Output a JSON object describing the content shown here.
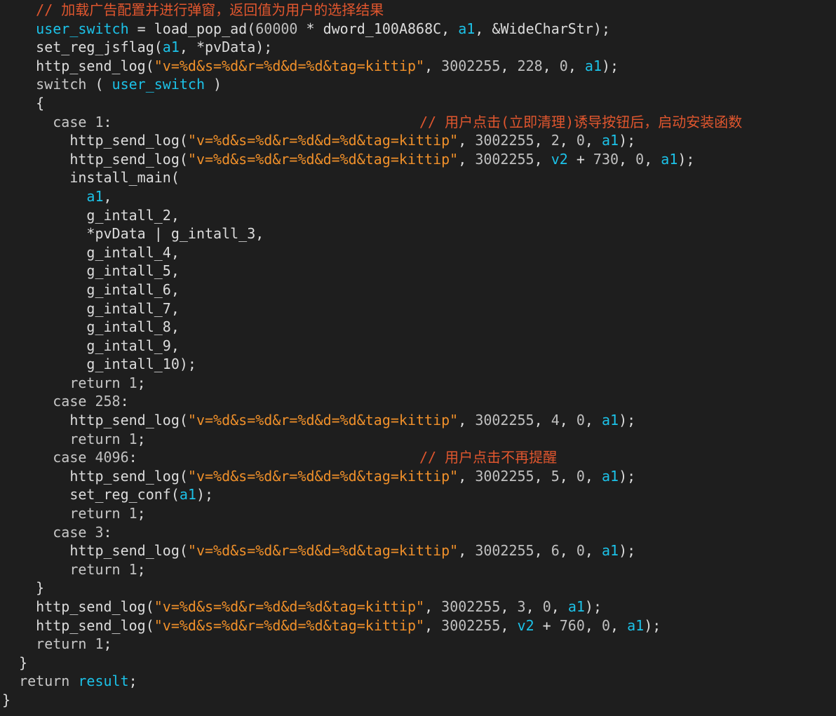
{
  "colors": {
    "background": "#1e1e1e",
    "plain": "#dcdcdc",
    "keyword": "#c8c8c8",
    "variable": "#1cc2e8",
    "string": "#f0902a",
    "number": "#c0c0c0",
    "comment": "#e0562e"
  },
  "lines": [
    {
      "indent": 2,
      "tokens": [
        {
          "t": "// 加载广告配置并进行弹窗，返回值为用户的选择结果",
          "c": "comment"
        }
      ]
    },
    {
      "indent": 2,
      "tokens": [
        {
          "t": "user_switch",
          "c": "variable"
        },
        {
          "t": " = load_pop_ad(",
          "c": "plain"
        },
        {
          "t": "60000",
          "c": "number"
        },
        {
          "t": " * dword_100A868C, ",
          "c": "plain"
        },
        {
          "t": "a1",
          "c": "variable"
        },
        {
          "t": ", &WideCharStr);",
          "c": "plain"
        }
      ]
    },
    {
      "indent": 2,
      "tokens": [
        {
          "t": "set_reg_jsflag(",
          "c": "plain"
        },
        {
          "t": "a1",
          "c": "variable"
        },
        {
          "t": ", *pvData);",
          "c": "plain"
        }
      ]
    },
    {
      "indent": 2,
      "tokens": [
        {
          "t": "http_send_log(",
          "c": "plain"
        },
        {
          "t": "\"v=%d&s=%d&r=%d&d=%d&tag=kittip\"",
          "c": "string"
        },
        {
          "t": ", ",
          "c": "plain"
        },
        {
          "t": "3002255",
          "c": "number"
        },
        {
          "t": ", ",
          "c": "plain"
        },
        {
          "t": "228",
          "c": "number"
        },
        {
          "t": ", ",
          "c": "plain"
        },
        {
          "t": "0",
          "c": "number"
        },
        {
          "t": ", ",
          "c": "plain"
        },
        {
          "t": "a1",
          "c": "variable"
        },
        {
          "t": ");",
          "c": "plain"
        }
      ]
    },
    {
      "indent": 2,
      "tokens": [
        {
          "t": "switch",
          "c": "keyword"
        },
        {
          "t": " ( ",
          "c": "plain"
        },
        {
          "t": "user_switch",
          "c": "variable"
        },
        {
          "t": " )",
          "c": "plain"
        }
      ]
    },
    {
      "indent": 2,
      "tokens": [
        {
          "t": "{",
          "c": "plain"
        }
      ]
    },
    {
      "indent": 3,
      "tokens": [
        {
          "t": "case",
          "c": "keyword"
        },
        {
          "t": " ",
          "c": "plain"
        },
        {
          "t": "1",
          "c": "number"
        },
        {
          "t": ":",
          "c": "plain"
        }
      ],
      "right_comment": "// 用户点击(立即清理)诱导按钮后，启动安装函数"
    },
    {
      "indent": 4,
      "tokens": [
        {
          "t": "http_send_log(",
          "c": "plain"
        },
        {
          "t": "\"v=%d&s=%d&r=%d&d=%d&tag=kittip\"",
          "c": "string"
        },
        {
          "t": ", ",
          "c": "plain"
        },
        {
          "t": "3002255",
          "c": "number"
        },
        {
          "t": ", ",
          "c": "plain"
        },
        {
          "t": "2",
          "c": "number"
        },
        {
          "t": ", ",
          "c": "plain"
        },
        {
          "t": "0",
          "c": "number"
        },
        {
          "t": ", ",
          "c": "plain"
        },
        {
          "t": "a1",
          "c": "variable"
        },
        {
          "t": ");",
          "c": "plain"
        }
      ]
    },
    {
      "indent": 4,
      "tokens": [
        {
          "t": "http_send_log(",
          "c": "plain"
        },
        {
          "t": "\"v=%d&s=%d&r=%d&d=%d&tag=kittip\"",
          "c": "string"
        },
        {
          "t": ", ",
          "c": "plain"
        },
        {
          "t": "3002255",
          "c": "number"
        },
        {
          "t": ", ",
          "c": "plain"
        },
        {
          "t": "v2",
          "c": "variable"
        },
        {
          "t": " + ",
          "c": "plain"
        },
        {
          "t": "730",
          "c": "number"
        },
        {
          "t": ", ",
          "c": "plain"
        },
        {
          "t": "0",
          "c": "number"
        },
        {
          "t": ", ",
          "c": "plain"
        },
        {
          "t": "a1",
          "c": "variable"
        },
        {
          "t": ");",
          "c": "plain"
        }
      ]
    },
    {
      "indent": 4,
      "tokens": [
        {
          "t": "install_main(",
          "c": "plain"
        }
      ]
    },
    {
      "indent": 5,
      "tokens": [
        {
          "t": "a1",
          "c": "variable"
        },
        {
          "t": ",",
          "c": "plain"
        }
      ]
    },
    {
      "indent": 5,
      "tokens": [
        {
          "t": "g_intall_2,",
          "c": "plain"
        }
      ]
    },
    {
      "indent": 5,
      "tokens": [
        {
          "t": "*pvData | g_intall_3,",
          "c": "plain"
        }
      ]
    },
    {
      "indent": 5,
      "tokens": [
        {
          "t": "g_intall_4,",
          "c": "plain"
        }
      ]
    },
    {
      "indent": 5,
      "tokens": [
        {
          "t": "g_intall_5,",
          "c": "plain"
        }
      ]
    },
    {
      "indent": 5,
      "tokens": [
        {
          "t": "g_intall_6,",
          "c": "plain"
        }
      ]
    },
    {
      "indent": 5,
      "tokens": [
        {
          "t": "g_intall_7,",
          "c": "plain"
        }
      ]
    },
    {
      "indent": 5,
      "tokens": [
        {
          "t": "g_intall_8,",
          "c": "plain"
        }
      ]
    },
    {
      "indent": 5,
      "tokens": [
        {
          "t": "g_intall_9,",
          "c": "plain"
        }
      ]
    },
    {
      "indent": 5,
      "tokens": [
        {
          "t": "g_intall_10);",
          "c": "plain"
        }
      ]
    },
    {
      "indent": 4,
      "tokens": [
        {
          "t": "return",
          "c": "keyword"
        },
        {
          "t": " ",
          "c": "plain"
        },
        {
          "t": "1",
          "c": "number"
        },
        {
          "t": ";",
          "c": "plain"
        }
      ]
    },
    {
      "indent": 3,
      "tokens": [
        {
          "t": "case",
          "c": "keyword"
        },
        {
          "t": " ",
          "c": "plain"
        },
        {
          "t": "258",
          "c": "number"
        },
        {
          "t": ":",
          "c": "plain"
        }
      ]
    },
    {
      "indent": 4,
      "tokens": [
        {
          "t": "http_send_log(",
          "c": "plain"
        },
        {
          "t": "\"v=%d&s=%d&r=%d&d=%d&tag=kittip\"",
          "c": "string"
        },
        {
          "t": ", ",
          "c": "plain"
        },
        {
          "t": "3002255",
          "c": "number"
        },
        {
          "t": ", ",
          "c": "plain"
        },
        {
          "t": "4",
          "c": "number"
        },
        {
          "t": ", ",
          "c": "plain"
        },
        {
          "t": "0",
          "c": "number"
        },
        {
          "t": ", ",
          "c": "plain"
        },
        {
          "t": "a1",
          "c": "variable"
        },
        {
          "t": ");",
          "c": "plain"
        }
      ]
    },
    {
      "indent": 4,
      "tokens": [
        {
          "t": "return",
          "c": "keyword"
        },
        {
          "t": " ",
          "c": "plain"
        },
        {
          "t": "1",
          "c": "number"
        },
        {
          "t": ";",
          "c": "plain"
        }
      ]
    },
    {
      "indent": 3,
      "tokens": [
        {
          "t": "case",
          "c": "keyword"
        },
        {
          "t": " ",
          "c": "plain"
        },
        {
          "t": "4096",
          "c": "number"
        },
        {
          "t": ":",
          "c": "plain"
        }
      ],
      "right_comment": "// 用户点击不再提醒"
    },
    {
      "indent": 4,
      "tokens": [
        {
          "t": "http_send_log(",
          "c": "plain"
        },
        {
          "t": "\"v=%d&s=%d&r=%d&d=%d&tag=kittip\"",
          "c": "string"
        },
        {
          "t": ", ",
          "c": "plain"
        },
        {
          "t": "3002255",
          "c": "number"
        },
        {
          "t": ", ",
          "c": "plain"
        },
        {
          "t": "5",
          "c": "number"
        },
        {
          "t": ", ",
          "c": "plain"
        },
        {
          "t": "0",
          "c": "number"
        },
        {
          "t": ", ",
          "c": "plain"
        },
        {
          "t": "a1",
          "c": "variable"
        },
        {
          "t": ");",
          "c": "plain"
        }
      ]
    },
    {
      "indent": 4,
      "tokens": [
        {
          "t": "set_reg_conf(",
          "c": "plain"
        },
        {
          "t": "a1",
          "c": "variable"
        },
        {
          "t": ");",
          "c": "plain"
        }
      ]
    },
    {
      "indent": 4,
      "tokens": [
        {
          "t": "return",
          "c": "keyword"
        },
        {
          "t": " ",
          "c": "plain"
        },
        {
          "t": "1",
          "c": "number"
        },
        {
          "t": ";",
          "c": "plain"
        }
      ]
    },
    {
      "indent": 3,
      "tokens": [
        {
          "t": "case",
          "c": "keyword"
        },
        {
          "t": " ",
          "c": "plain"
        },
        {
          "t": "3",
          "c": "number"
        },
        {
          "t": ":",
          "c": "plain"
        }
      ]
    },
    {
      "indent": 4,
      "tokens": [
        {
          "t": "http_send_log(",
          "c": "plain"
        },
        {
          "t": "\"v=%d&s=%d&r=%d&d=%d&tag=kittip\"",
          "c": "string"
        },
        {
          "t": ", ",
          "c": "plain"
        },
        {
          "t": "3002255",
          "c": "number"
        },
        {
          "t": ", ",
          "c": "plain"
        },
        {
          "t": "6",
          "c": "number"
        },
        {
          "t": ", ",
          "c": "plain"
        },
        {
          "t": "0",
          "c": "number"
        },
        {
          "t": ", ",
          "c": "plain"
        },
        {
          "t": "a1",
          "c": "variable"
        },
        {
          "t": ");",
          "c": "plain"
        }
      ]
    },
    {
      "indent": 4,
      "tokens": [
        {
          "t": "return",
          "c": "keyword"
        },
        {
          "t": " ",
          "c": "plain"
        },
        {
          "t": "1",
          "c": "number"
        },
        {
          "t": ";",
          "c": "plain"
        }
      ]
    },
    {
      "indent": 2,
      "tokens": [
        {
          "t": "}",
          "c": "plain"
        }
      ]
    },
    {
      "indent": 2,
      "tokens": [
        {
          "t": "http_send_log(",
          "c": "plain"
        },
        {
          "t": "\"v=%d&s=%d&r=%d&d=%d&tag=kittip\"",
          "c": "string"
        },
        {
          "t": ", ",
          "c": "plain"
        },
        {
          "t": "3002255",
          "c": "number"
        },
        {
          "t": ", ",
          "c": "plain"
        },
        {
          "t": "3",
          "c": "number"
        },
        {
          "t": ", ",
          "c": "plain"
        },
        {
          "t": "0",
          "c": "number"
        },
        {
          "t": ", ",
          "c": "plain"
        },
        {
          "t": "a1",
          "c": "variable"
        },
        {
          "t": ");",
          "c": "plain"
        }
      ]
    },
    {
      "indent": 2,
      "tokens": [
        {
          "t": "http_send_log(",
          "c": "plain"
        },
        {
          "t": "\"v=%d&s=%d&r=%d&d=%d&tag=kittip\"",
          "c": "string"
        },
        {
          "t": ", ",
          "c": "plain"
        },
        {
          "t": "3002255",
          "c": "number"
        },
        {
          "t": ", ",
          "c": "plain"
        },
        {
          "t": "v2",
          "c": "variable"
        },
        {
          "t": " + ",
          "c": "plain"
        },
        {
          "t": "760",
          "c": "number"
        },
        {
          "t": ", ",
          "c": "plain"
        },
        {
          "t": "0",
          "c": "number"
        },
        {
          "t": ", ",
          "c": "plain"
        },
        {
          "t": "a1",
          "c": "variable"
        },
        {
          "t": ");",
          "c": "plain"
        }
      ]
    },
    {
      "indent": 2,
      "tokens": [
        {
          "t": "return",
          "c": "keyword"
        },
        {
          "t": " ",
          "c": "plain"
        },
        {
          "t": "1",
          "c": "number"
        },
        {
          "t": ";",
          "c": "plain"
        }
      ]
    },
    {
      "indent": 1,
      "tokens": [
        {
          "t": "}",
          "c": "plain"
        }
      ]
    },
    {
      "indent": 1,
      "tokens": [
        {
          "t": "return",
          "c": "keyword"
        },
        {
          "t": " ",
          "c": "plain"
        },
        {
          "t": "result",
          "c": "variable"
        },
        {
          "t": ";",
          "c": "plain"
        }
      ]
    },
    {
      "indent": 0,
      "tokens": [
        {
          "t": "}",
          "c": "plain"
        }
      ]
    }
  ]
}
